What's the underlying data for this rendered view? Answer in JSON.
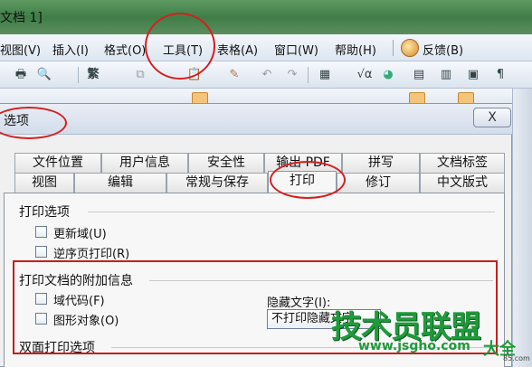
{
  "window": {
    "title": "文档 1]"
  },
  "menu": [
    {
      "label": "视图(V)"
    },
    {
      "label": "插入(I)"
    },
    {
      "label": "格式(O)"
    },
    {
      "label": "工具(T)"
    },
    {
      "label": "表格(A)"
    },
    {
      "label": "窗口(W)"
    },
    {
      "label": "帮助(H)"
    },
    {
      "label": "反馈(B)"
    }
  ],
  "toolbar": {
    "simplified_label": "繁"
  },
  "dialog": {
    "title": "选项",
    "close_label": "X",
    "tabs_back": [
      "文件位置",
      "用户信息",
      "安全性",
      "输出 PDF",
      "拼写",
      "文档标签"
    ],
    "tabs_front": [
      "视图",
      "编辑",
      "常规与保存",
      "打印",
      "修订",
      "中文版式"
    ],
    "active_tab": "打印",
    "print_options": {
      "label": "打印选项",
      "items": [
        "更新域(U)",
        "逆序页打印(R)"
      ]
    },
    "extra_info": {
      "label": "打印文档的附加信息",
      "items": [
        "域代码(F)",
        "图形对象(O)"
      ],
      "hidden_text_label": "隐藏文字(I):",
      "hidden_text_value": "不打印隐藏文字"
    },
    "duplex": {
      "label": "双面打印选项"
    }
  },
  "watermark": {
    "brand": "技术员联盟",
    "url": "www.jsgho.com",
    "extra": "大全",
    "tiny": "85.com"
  },
  "colors": {
    "annotation": "#d42020",
    "watermark": "#1f9a3a"
  }
}
